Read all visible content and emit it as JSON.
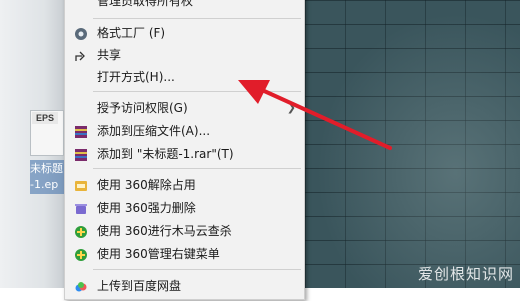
{
  "desktop": {
    "file_tag": "EPS",
    "file_name_line1": "未标题",
    "file_name_line2": "-1.ep"
  },
  "menu": {
    "items": [
      {
        "label": "管理员取得所有权",
        "icon": "none"
      },
      {
        "label": "格式工厂 (F)",
        "icon": "format-factory-icon"
      },
      {
        "label": "共享",
        "icon": "share-icon"
      },
      {
        "label": "打开方式(H)...",
        "icon": "none"
      },
      {
        "label": "授予访问权限(G)",
        "icon": "none",
        "submenu": true
      },
      {
        "label": "添加到压缩文件(A)...",
        "icon": "winrar-icon"
      },
      {
        "label": "添加到 \"未标题-1.rar\"(T)",
        "icon": "winrar-icon"
      },
      {
        "label": "使用 360解除占用",
        "icon": "360-unlock-icon"
      },
      {
        "label": "使用 360强力删除",
        "icon": "360-delete-icon"
      },
      {
        "label": "使用 360进行木马云查杀",
        "icon": "360-scan-icon"
      },
      {
        "label": "使用 360管理右键菜单",
        "icon": "360-manage-icon"
      },
      {
        "label": "上传到百度网盘",
        "icon": "baidu-cloud-icon"
      }
    ]
  },
  "watermark": "爱创根知识网",
  "colors": {
    "menu_bg": "#f2f2f2",
    "arrow": "#e11d2a",
    "desktop": "#3e5b63"
  }
}
